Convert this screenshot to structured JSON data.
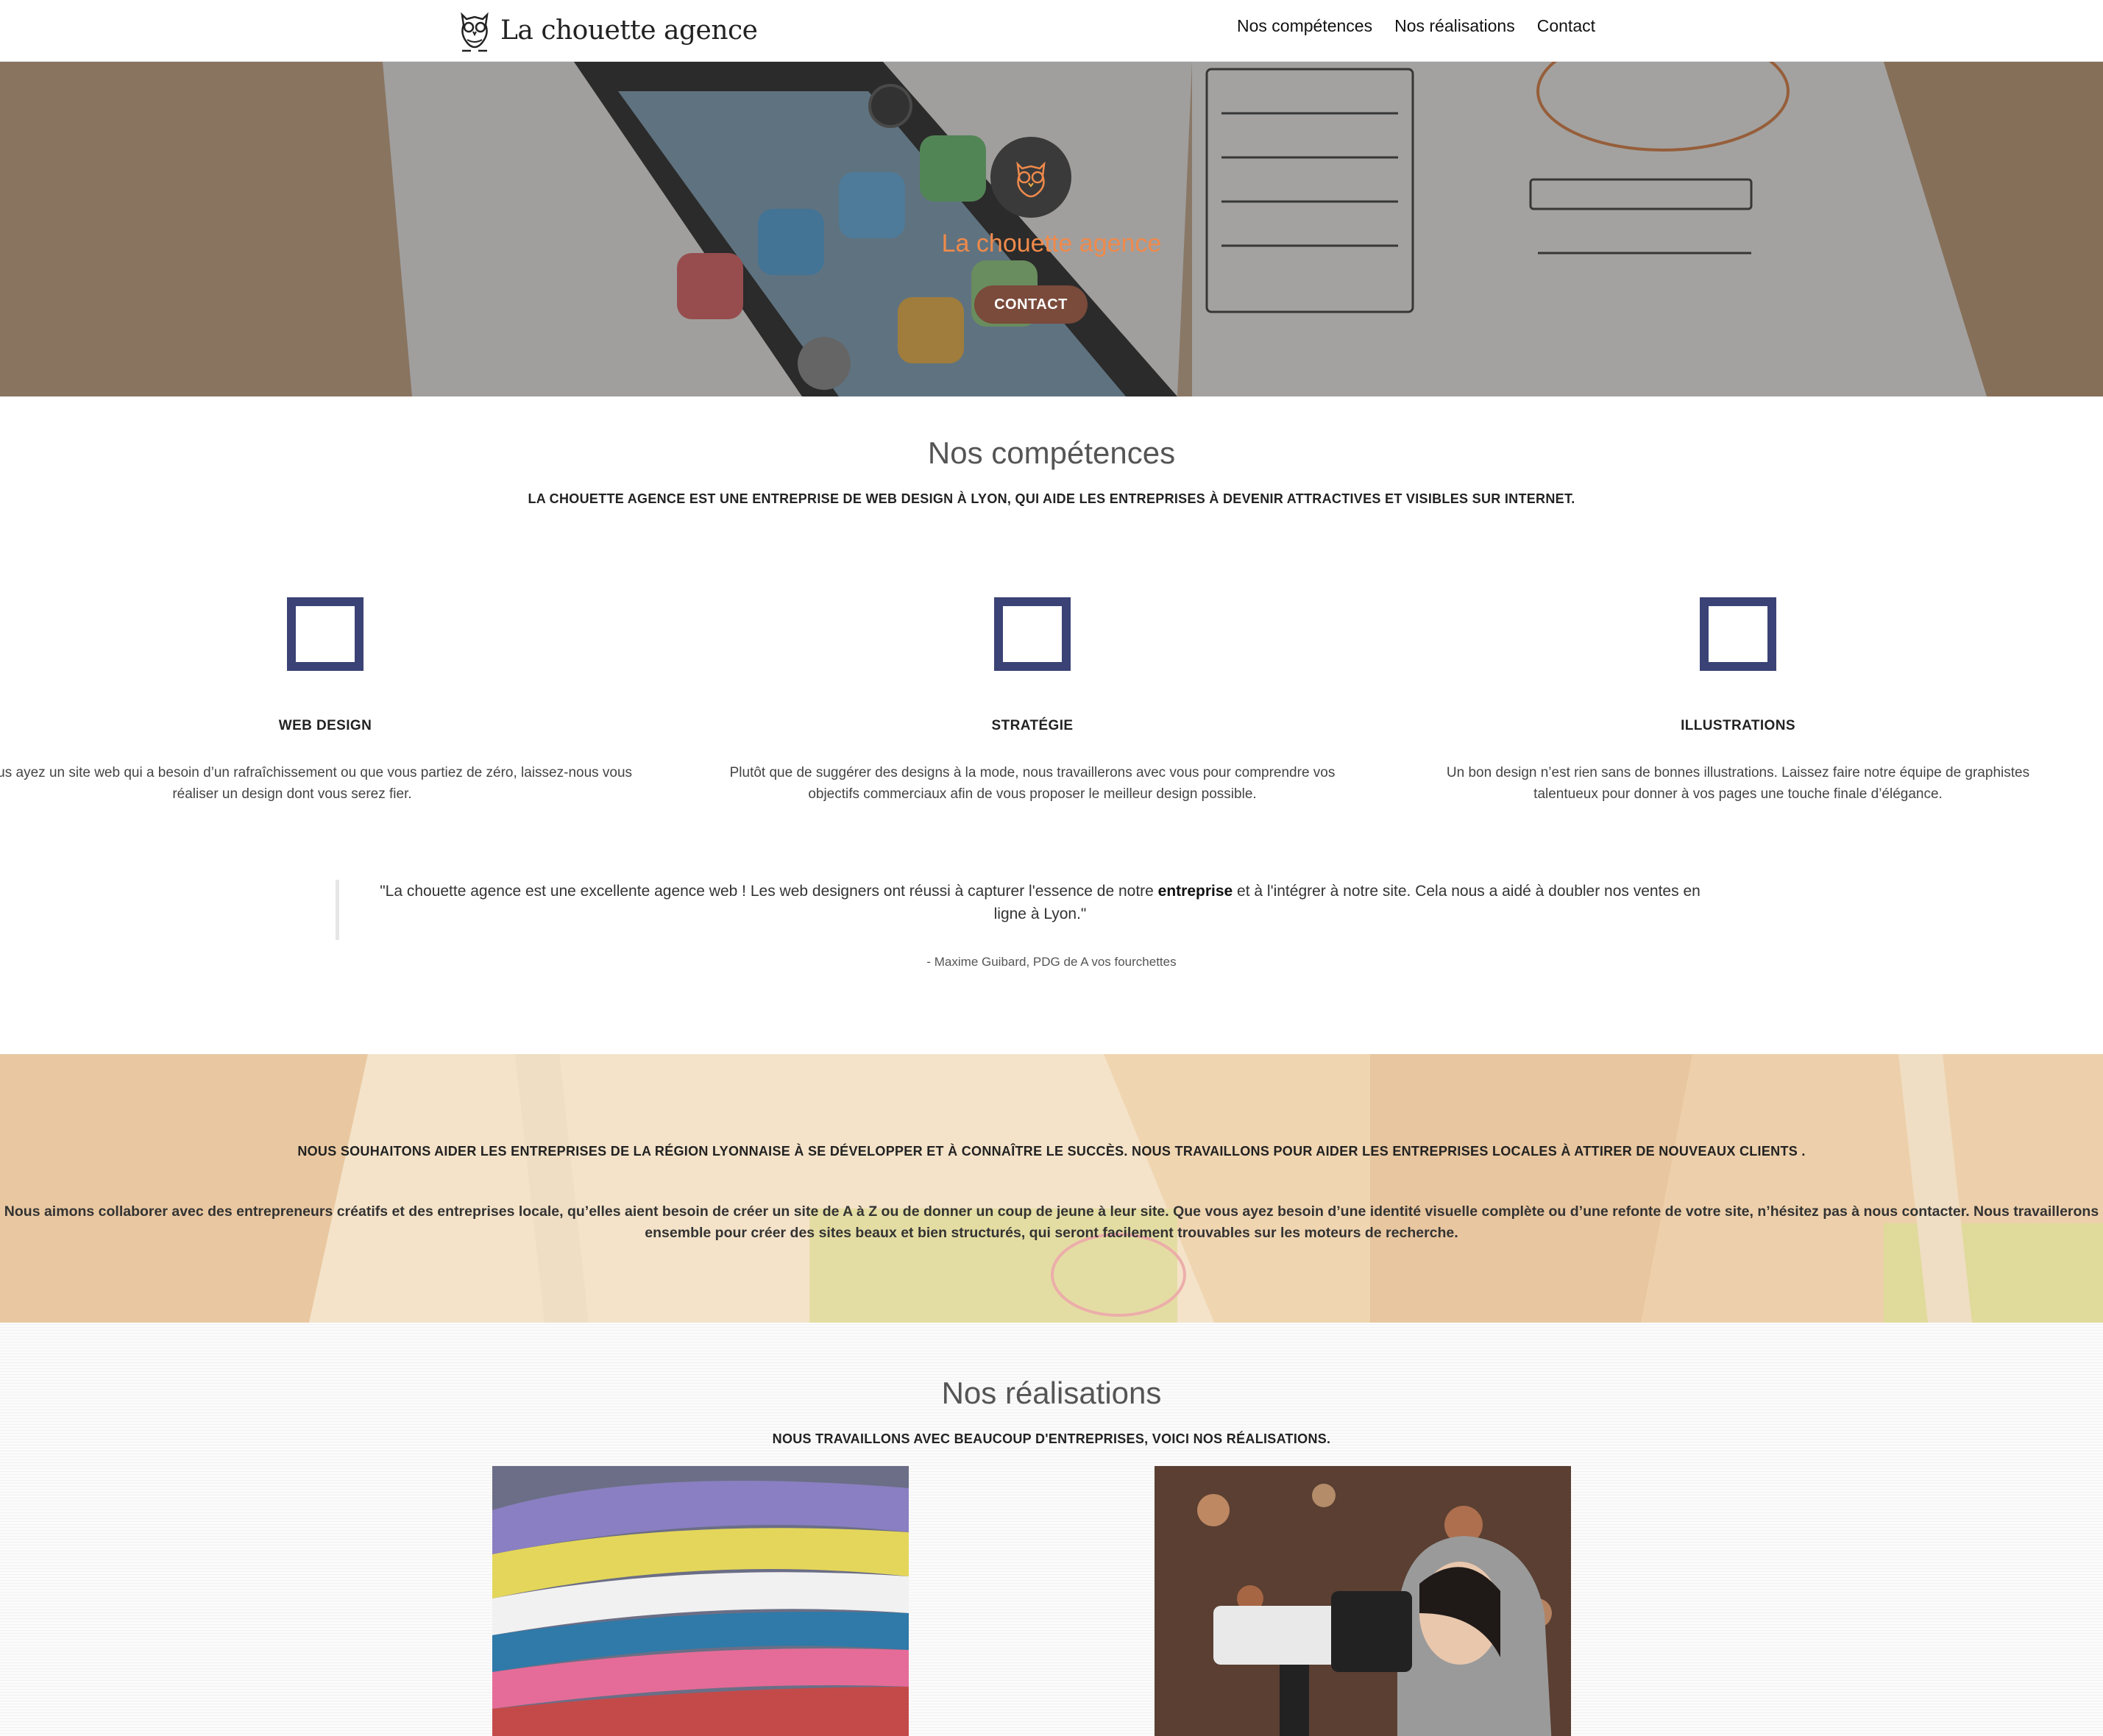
{
  "nav": {
    "brand": "La chouette agence",
    "links": [
      "Nos compétences",
      "Nos réalisations",
      "Contact"
    ]
  },
  "hero": {
    "title": "La chouette agence",
    "button": "CONTACT",
    "logo_icon": "owl-icon"
  },
  "competences": {
    "title": "Nos compétences",
    "subtitle": "LA CHOUETTE AGENCE EST UNE ENTREPRISE DE WEB DESIGN À LYON, QUI AIDE LES ENTREPRISES À DEVENIR ATTRACTIVES ET VISIBLES SUR INTERNET.",
    "items": [
      {
        "name": "WEB DESIGN",
        "desc": "Que vous ayez un site web qui a besoin d’un rafraîchissement ou que vous partiez de zéro, laissez-nous vous réaliser un design dont vous serez fier."
      },
      {
        "name": "STRATÉGIE",
        "desc": "Plutôt que de suggérer des designs à la mode, nous travaillerons avec vous pour comprendre vos objectifs commerciaux afin de vous proposer le meilleur design possible."
      },
      {
        "name": "ILLUSTRATIONS",
        "desc": "Un bon design n’est rien sans de bonnes illustrations. Laissez faire notre équipe de graphistes talentueux pour donner à vos pages une touche finale d’élégance."
      }
    ],
    "quote": {
      "before": "\"La chouette agence est une excellente agence web ! Les web designers ont réussi à capturer l'essence de notre ",
      "bold": "entreprise",
      "after": " et à l'intégrer à notre site. Cela nous a aidé à doubler nos ventes en ligne à Lyon.\"",
      "author": "- Maxime Guibard, PDG de A vos fourchettes"
    }
  },
  "band": {
    "title": "NOUS SOUHAITONS AIDER LES ENTREPRISES DE LA RÉGION LYONNAISE À SE DÉVELOPPER ET À CONNAÎTRE LE SUCCÈS. NOUS TRAVAILLONS POUR AIDER LES ENTREPRISES LOCALES À ATTIRER DE NOUVEAUX CLIENTS .",
    "text": "Nous aimons collaborer avec des entrepreneurs créatifs et des entreprises locale, qu’elles aient besoin de créer un site de A à Z ou de donner un coup de jeune à leur site. Que vous ayez besoin d’une identité visuelle complète ou d’une refonte de votre site, n’hésitez pas à nous contacter. Nous travaillerons ensemble pour créer des sites beaux et bien structurés, qui seront facilement trouvables sur les moteurs de recherche."
  },
  "realisations": {
    "title": "Nos réalisations",
    "subtitle": "NOUS TRAVAILLONS AVEC BEAUCOUP D'ENTREPRISES, VOICI NOS RÉALISATIONS."
  }
}
